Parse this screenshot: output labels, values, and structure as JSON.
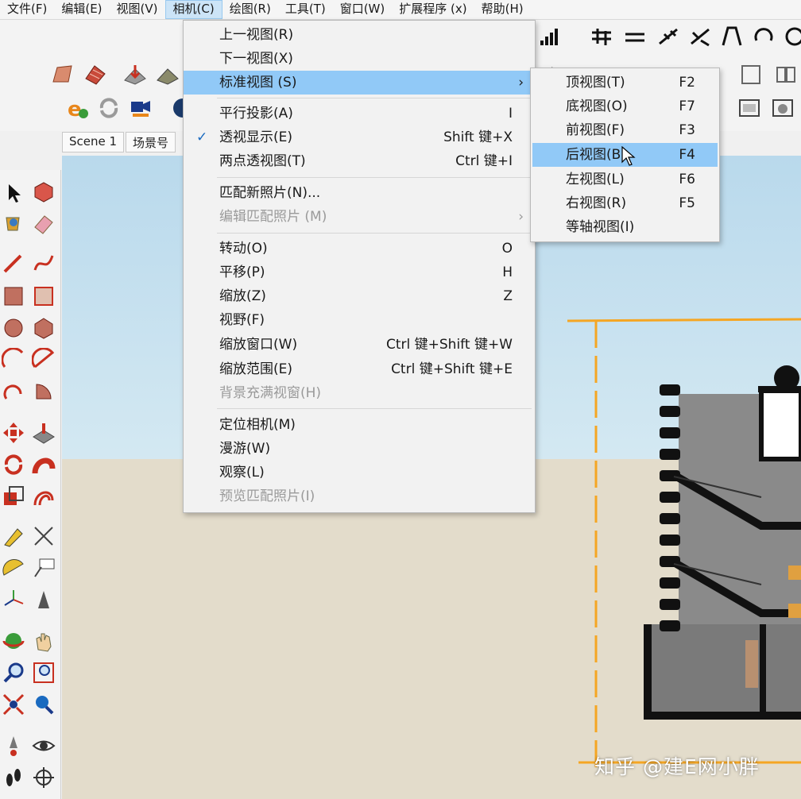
{
  "menubar": [
    "文件(F)",
    "编辑(E)",
    "视图(V)",
    "相机(C)",
    "绘图(R)",
    "工具(T)",
    "窗口(W)",
    "扩展程序 (x)",
    "帮助(H)"
  ],
  "scene_tabs": [
    "Scene 1",
    "场景号"
  ],
  "camera_menu": {
    "items": [
      {
        "label": "上一视图(R)",
        "shortcut": ""
      },
      {
        "label": "下一视图(X)",
        "shortcut": ""
      },
      {
        "label": "标准视图 (S)",
        "shortcut": "›",
        "highlighted": true
      },
      {
        "label": "平行投影(A)",
        "shortcut": "I"
      },
      {
        "label": "透视显示(E)",
        "shortcut": "Shift 键+X",
        "checked": true
      },
      {
        "label": "两点透视图(T)",
        "shortcut": "Ctrl 键+I"
      },
      {
        "label": "匹配新照片(N)...",
        "shortcut": ""
      },
      {
        "label": "编辑匹配照片 (M)",
        "shortcut": "›",
        "disabled": true
      },
      {
        "label": "转动(O)",
        "shortcut": "O"
      },
      {
        "label": "平移(P)",
        "shortcut": "H"
      },
      {
        "label": "缩放(Z)",
        "shortcut": "Z"
      },
      {
        "label": "视野(F)",
        "shortcut": ""
      },
      {
        "label": "缩放窗口(W)",
        "shortcut": "Ctrl 键+Shift 键+W"
      },
      {
        "label": "缩放范围(E)",
        "shortcut": "Ctrl 键+Shift 键+E"
      },
      {
        "label": "背景充满视窗(H)",
        "shortcut": "",
        "disabled": true
      },
      {
        "label": "定位相机(M)",
        "shortcut": ""
      },
      {
        "label": "漫游(W)",
        "shortcut": ""
      },
      {
        "label": "观察(L)",
        "shortcut": ""
      },
      {
        "label": "预览匹配照片(I)",
        "shortcut": "",
        "disabled": true
      }
    ],
    "check_mark": "✓"
  },
  "standard_views_menu": {
    "items": [
      {
        "label": "顶视图(T)",
        "shortcut": "F2"
      },
      {
        "label": "底视图(O)",
        "shortcut": "F7"
      },
      {
        "label": "前视图(F)",
        "shortcut": "F3"
      },
      {
        "label": "后视图(B)",
        "shortcut": "F4",
        "highlighted": true
      },
      {
        "label": "左视图(L)",
        "shortcut": "F6"
      },
      {
        "label": "右视图(R)",
        "shortcut": "F5"
      },
      {
        "label": "等轴视图(I)",
        "shortcut": ""
      }
    ]
  },
  "watermark": "知乎 @建E网小胖",
  "colors": {
    "highlight": "#91c9f7",
    "menu_bg": "#f2f2f2",
    "bbox": "#f5a623",
    "sky": "#c7e2f0",
    "ground": "#e3dccb"
  }
}
